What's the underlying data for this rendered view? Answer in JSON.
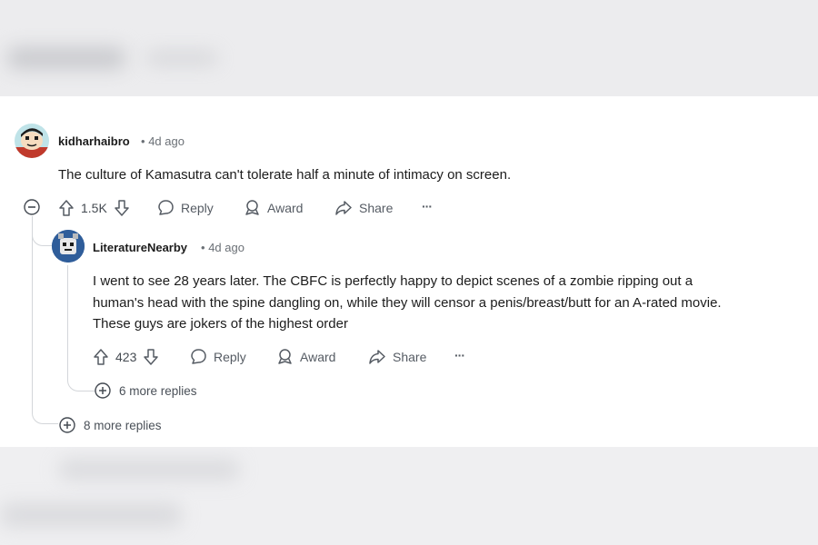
{
  "comments": [
    {
      "username": "kidharhaibro",
      "time": "4d ago",
      "body": "The culture of Kamasutra can't tolerate half a minute of intimacy on screen.",
      "score": "1.5K",
      "actions": {
        "reply": "Reply",
        "award": "Award",
        "share": "Share",
        "more": "···"
      }
    },
    {
      "username": "LiteratureNearby",
      "time": "4d ago",
      "body_lines": [
        "I went to see 28 years later. The CBFC is perfectly happy to depict scenes of a zombie ripping out a",
        "human's head with the spine dangling on, while they will censor a penis/breast/butt for an A-rated movie.",
        "These guys are jokers of the highest order"
      ],
      "score": "423",
      "actions": {
        "reply": "Reply",
        "award": "Award",
        "share": "Share",
        "more": "···"
      }
    }
  ],
  "separator": "•",
  "nested_more_replies": "6 more replies",
  "top_more_replies": "8 more replies",
  "icons": {
    "collapse": "minus-circle-icon",
    "upvote": "arrow-up-icon",
    "downvote": "arrow-down-icon",
    "reply": "speech-bubble-icon",
    "award": "award-icon",
    "share": "share-arrow-icon",
    "expand": "plus-circle-icon"
  },
  "colors": {
    "text": "#1c1c1c",
    "muted": "#6b7076",
    "thread": "#d3d6da",
    "avatar1_bg": "#bfe3e8",
    "avatar2_bg": "#2f5d9a"
  }
}
